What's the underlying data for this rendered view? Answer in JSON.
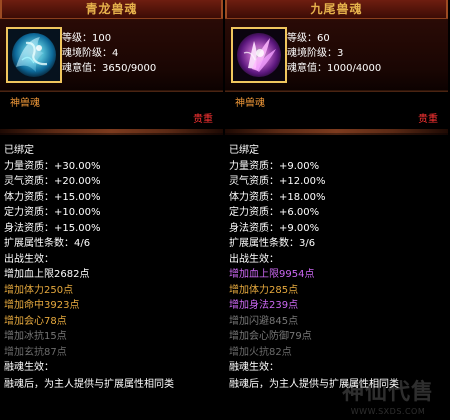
{
  "colors": {
    "background": "#000000",
    "title": "#e6b24c",
    "subtitle": "#f39a39",
    "rarity": "#ff3333",
    "white": "#ffffff",
    "gold": "#e6a93e",
    "purple": "#cb68f2",
    "gray": "#777777"
  },
  "watermark": {
    "text": "神仙代售",
    "url": "WWW.SXDS.COM"
  },
  "panels": [
    {
      "title": "青龙兽魂",
      "icon": "azure-dragon-soul-icon",
      "level": "等级：100",
      "tier": "魂境阶级：4",
      "soul_value": "魂意值：3650/9000",
      "type": "神兽魂",
      "rarity": "贵重",
      "bound": "已绑定",
      "stats": {
        "strength": "力量资质：+30.00%",
        "spirit": "灵气资质：+20.00%",
        "stamina": "体力资质：+15.00%",
        "focus": "定力资质：+10.00%",
        "agility": "身法资质：+15.00%",
        "extra": "扩展属性条数：4/6"
      },
      "battle": {
        "header": "出战生效：",
        "lines": [
          {
            "text": "增加血上限2682点",
            "tone": "white"
          },
          {
            "text": "增加体力250点",
            "tone": "gold"
          },
          {
            "text": "增加命中3923点",
            "tone": "gold"
          },
          {
            "text": "增加会心78点",
            "tone": "gold"
          },
          {
            "text": "增加冰抗15点",
            "tone": "gray"
          },
          {
            "text": "增加玄抗87点",
            "tone": "gray"
          }
        ]
      },
      "fusion": {
        "header": "融魂生效：",
        "text": "融魂后，为主人提供与扩展属性相同类"
      }
    },
    {
      "title": "九尾兽魂",
      "icon": "nine-tailed-fox-soul-icon",
      "level": "等级：60",
      "tier": "魂境阶级：3",
      "soul_value": "魂意值：1000/4000",
      "type": "神兽魂",
      "rarity": "贵重",
      "bound": "已绑定",
      "stats": {
        "strength": "力量资质：+9.00%",
        "spirit": "灵气资质：+12.00%",
        "stamina": "体力资质：+18.00%",
        "focus": "定力资质：+6.00%",
        "agility": "身法资质：+9.00%",
        "extra": "扩展属性条数：3/6"
      },
      "battle": {
        "header": "出战生效：",
        "lines": [
          {
            "text": "增加血上限9954点",
            "tone": "purple"
          },
          {
            "text": "增加体力285点",
            "tone": "gold"
          },
          {
            "text": "增加身法239点",
            "tone": "purple"
          },
          {
            "text": "增加闪避845点",
            "tone": "gray"
          },
          {
            "text": "增加会心防御79点",
            "tone": "gray"
          },
          {
            "text": "增加火抗82点",
            "tone": "gray"
          }
        ]
      },
      "fusion": {
        "header": "融魂生效：",
        "text": "融魂后，为主人提供与扩展属性相同类"
      }
    }
  ]
}
